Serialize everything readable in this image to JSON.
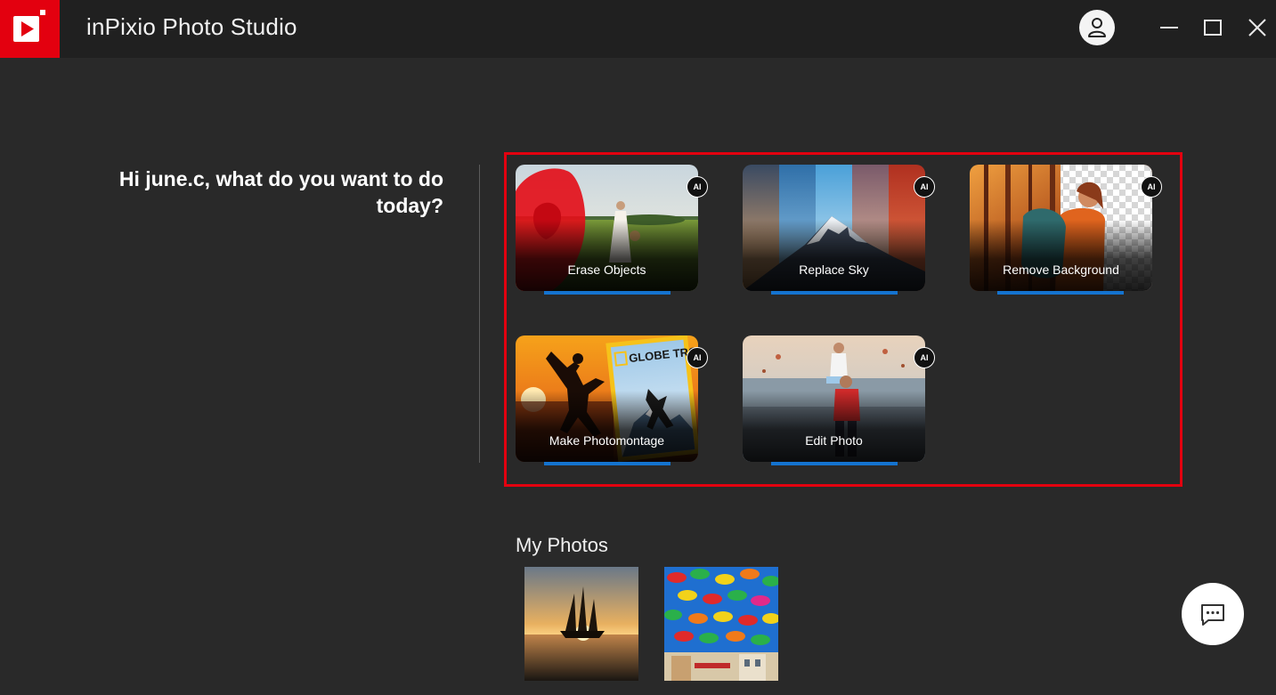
{
  "app": {
    "title": "inPixio Photo Studio"
  },
  "greeting": "Hi june.c, what do you want to do today?",
  "features": [
    {
      "label": "Erase Objects",
      "badge": "AI"
    },
    {
      "label": "Replace Sky",
      "badge": "AI"
    },
    {
      "label": "Remove Background",
      "badge": "AI"
    },
    {
      "label": "Make Photomontage",
      "badge": "AI",
      "magazine_title": "GLOBE TROTTER"
    },
    {
      "label": "Edit Photo",
      "badge": "AI"
    }
  ],
  "my_photos": {
    "title": "My Photos"
  },
  "colors": {
    "brand_red": "#e3000f",
    "accent_blue": "#1473cf",
    "background": "#292929",
    "titlebar": "#202020"
  },
  "icons": {
    "logo": "inpixio-play-logo",
    "account": "user-icon",
    "minimize": "minimize-icon",
    "maximize": "maximize-icon",
    "close": "close-icon",
    "chat": "chat-bubble-icon"
  }
}
